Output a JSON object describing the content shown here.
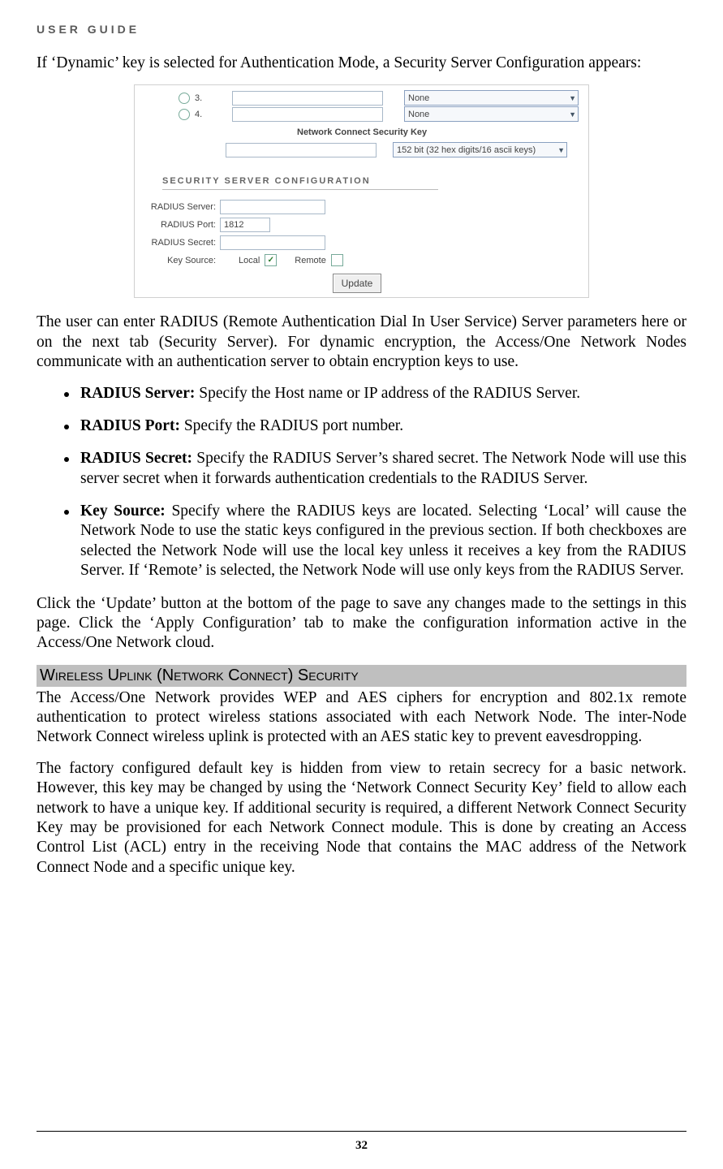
{
  "header": "USER GUIDE",
  "intro": "If ‘Dynamic’ key is selected for Authentication Mode, a Security Server Configuration appears:",
  "screenshot": {
    "row3": "3.",
    "row4": "4.",
    "none": "None",
    "net_sec_title": "Network Connect Security Key",
    "net_sec_value": "152 bit (32 hex digits/16 ascii keys)",
    "section_title": "SECURITY SERVER CONFIGURATION",
    "radius_server_label": "RADIUS Server:",
    "radius_port_label": "RADIUS Port:",
    "radius_port_value": "1812",
    "radius_secret_label": "RADIUS Secret:",
    "key_source_label": "Key Source:",
    "local_label": "Local",
    "remote_label": "Remote",
    "update_btn": "Update"
  },
  "para_after": "The user can enter RADIUS (Remote Authentication Dial In User Service) Server parameters here or on the next tab (Security Server). For dynamic encryption, the Access/One Network Nodes communicate with an authentication server to obtain encryption keys to use.",
  "bullets": [
    {
      "label": "RADIUS Server:",
      "text": " Specify the Host name or IP address of the RADIUS Server."
    },
    {
      "label": "RADIUS Port:",
      "text": " Specify the RADIUS port number."
    },
    {
      "label": "RADIUS Secret:",
      "text": " Specify the RADIUS Server’s shared secret. The Network Node will use this server secret when it forwards authentication credentials to the RADIUS Server."
    },
    {
      "label": "Key Source:",
      "text": " Specify where the RADIUS keys are located. Selecting ‘Local’ will cause the Network Node to use the static keys configured in the previous section. If both checkboxes are selected the Network Node will use the local key unless it receives a key from the RADIUS Server. If ‘Remote’ is selected, the Network Node will use only keys from the RADIUS Server."
    }
  ],
  "update_para": "Click the ‘Update’ button at the bottom of the page to save any changes made to the settings in this page. Click the ‘Apply Configuration’ tab to make the configuration information active in the Access/One Network cloud.",
  "section_heading": "Wireless Uplink (Network Connect) Security",
  "section_p1": "The Access/One Network provides WEP and AES ciphers for encryption and 802.1x remote authentication to protect wireless stations associated with each Network Node. The inter-Node Network Connect wireless uplink is protected with an AES static key to prevent eavesdropping.",
  "section_p2": "The factory configured default key is hidden from view to retain secrecy for a basic network. However, this key may be changed by using the ‘Network Connect Security Key’ field to allow each network to have a unique key. If additional security is required, a different Network Connect Security Key may be provisioned for each Network Connect module. This is done by creating an Access Control List (ACL) entry in the receiving Node that contains the MAC address of the Network Connect Node and a specific unique key.",
  "page_num": "32"
}
